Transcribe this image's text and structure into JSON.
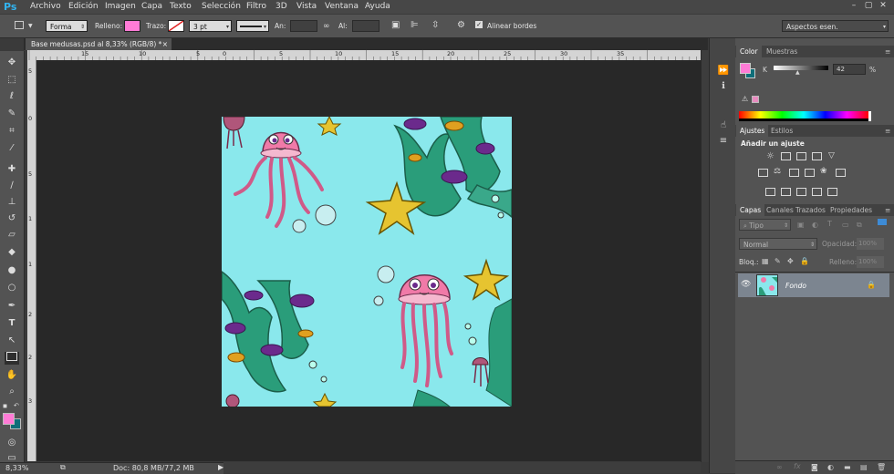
{
  "app": {
    "logo": "Ps"
  },
  "menu": [
    "Archivo",
    "Edición",
    "Imagen",
    "Capa",
    "Texto",
    "Selección",
    "Filtro",
    "3D",
    "Vista",
    "Ventana",
    "Ayuda"
  ],
  "window_buttons": [
    "–",
    "▢",
    "✕"
  ],
  "options": {
    "mode": "Forma",
    "fill_label": "Relleno:",
    "fill_color": "#ff7bd6",
    "stroke_label": "Trazo:",
    "stroke_width": "3 pt",
    "width_label": "An:",
    "height_label": "Al:",
    "align_edges": "Alinear bordes",
    "workspace": "Aspectos esen."
  },
  "document": {
    "tab_title": "Base medusas.psd al 8,33% (RGB/8) *",
    "close": "×",
    "canvas_color": "#8ae8ec"
  },
  "ruler": {
    "top": [
      "15",
      "10",
      "5",
      "0",
      "5",
      "10",
      "15",
      "20",
      "25",
      "30",
      "35"
    ],
    "left": [
      "5",
      "0",
      "5",
      "1",
      "1",
      "2",
      "2",
      "3"
    ]
  },
  "status": {
    "zoom": "8,33%",
    "doc": "Doc: 80,8 MB/77,2 MB"
  },
  "color_panel": {
    "tabs": [
      "Color",
      "Muestras"
    ],
    "channel": "K",
    "value": "42",
    "unit": "%",
    "foreground": "#ff7bd6",
    "background": "#0f6e79"
  },
  "adjustments_panel": {
    "tabs": [
      "Ajustes",
      "Estilos"
    ],
    "heading": "Añadir un ajuste"
  },
  "layers_panel": {
    "tabs": [
      "Capas",
      "Canales",
      "Trazados",
      "Propiedades"
    ],
    "filter_kind": "Tipo",
    "blend_mode": "Normal",
    "opacity_label": "Opacidad:",
    "opacity_value": "100%",
    "lock_label": "Bloq.:",
    "fill_label": "Relleno:",
    "fill_value": "100%",
    "layers": [
      {
        "name": "Fondo",
        "locked": true,
        "visible": true
      }
    ]
  }
}
